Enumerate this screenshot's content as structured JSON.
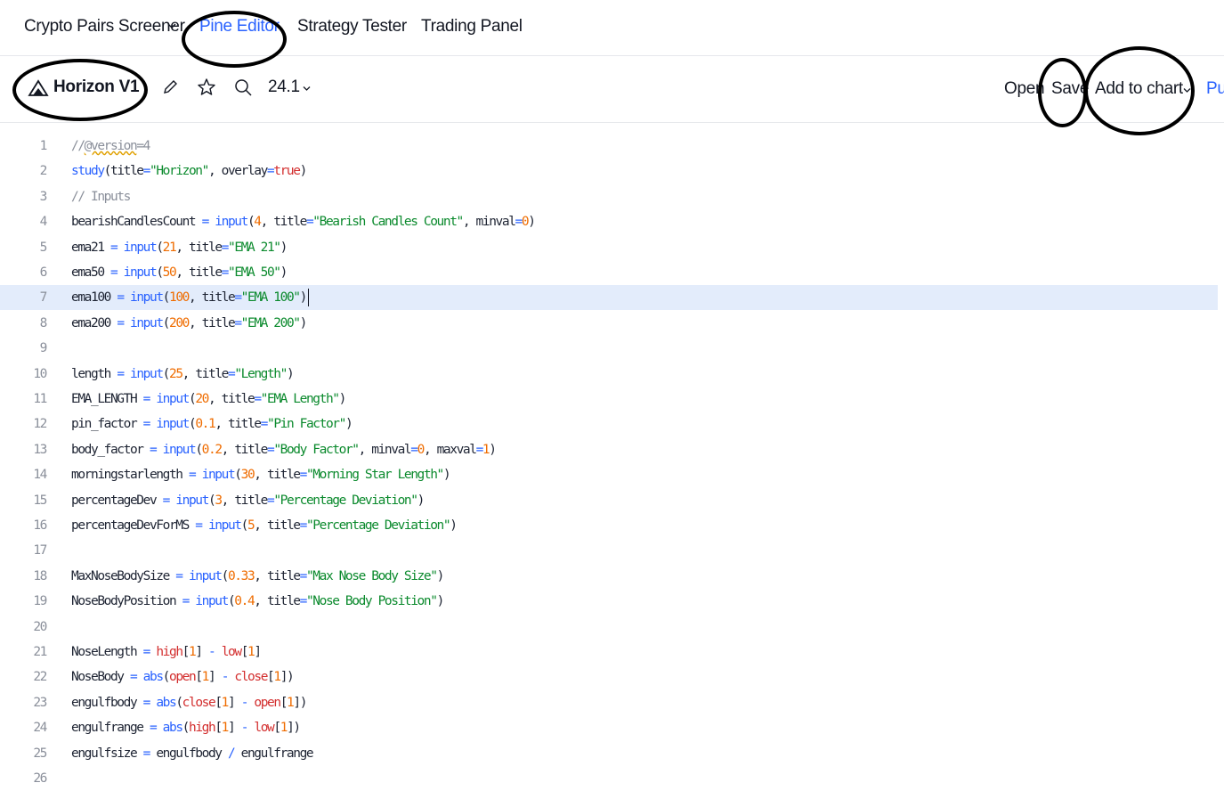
{
  "tabs": {
    "screener": "Crypto Pairs Screener",
    "pine_editor": "Pine Editor",
    "strategy_tester": "Strategy Tester",
    "trading_panel": "Trading Panel"
  },
  "toolbar": {
    "script_name": "Horizon V1",
    "version": "24.1",
    "open": "Open",
    "save": "Save",
    "add_to_chart": "Add to chart",
    "publish": "Pu"
  },
  "colors": {
    "accent": "#2962ff",
    "string": "#0b8a2d",
    "number": "#ef6c00",
    "builtin_var": "#d32f2f",
    "comment": "#8a8f9a",
    "highlight_line": "#e3ecfb"
  },
  "editor": {
    "highlighted_line": 7,
    "lines": [
      {
        "n": "1",
        "t": "//@version=4"
      },
      {
        "n": "2",
        "t": "study(title=\"Horizon\", overlay=true)"
      },
      {
        "n": "3",
        "t": "// Inputs"
      },
      {
        "n": "4",
        "t": "bearishCandlesCount = input(4, title=\"Bearish Candles Count\", minval=0)"
      },
      {
        "n": "5",
        "t": "ema21 = input(21, title=\"EMA 21\")"
      },
      {
        "n": "6",
        "t": "ema50 = input(50, title=\"EMA 50\")"
      },
      {
        "n": "7",
        "t": "ema100 = input(100, title=\"EMA 100\")"
      },
      {
        "n": "8",
        "t": "ema200 = input(200, title=\"EMA 200\")"
      },
      {
        "n": "9",
        "t": ""
      },
      {
        "n": "10",
        "t": "length = input(25, title=\"Length\")"
      },
      {
        "n": "11",
        "t": "EMA_LENGTH = input(20, title=\"EMA Length\")"
      },
      {
        "n": "12",
        "t": "pin_factor = input(0.1, title=\"Pin Factor\")"
      },
      {
        "n": "13",
        "t": "body_factor = input(0.2, title=\"Body Factor\", minval=0, maxval=1)"
      },
      {
        "n": "14",
        "t": "morningstarlength = input(30, title=\"Morning Star Length\")"
      },
      {
        "n": "15",
        "t": "percentageDev = input(3, title=\"Percentage Deviation\")"
      },
      {
        "n": "16",
        "t": "percentageDevForMS = input(5, title=\"Percentage Deviation\")"
      },
      {
        "n": "17",
        "t": ""
      },
      {
        "n": "18",
        "t": "MaxNoseBodySize = input(0.33, title=\"Max Nose Body Size\")"
      },
      {
        "n": "19",
        "t": "NoseBodyPosition = input(0.4, title=\"Nose Body Position\")"
      },
      {
        "n": "20",
        "t": ""
      },
      {
        "n": "21",
        "t": "NoseLength = high[1] - low[1]"
      },
      {
        "n": "22",
        "t": "NoseBody = abs(open[1] - close[1])"
      },
      {
        "n": "23",
        "t": "engulfbody = abs(close[1] - open[1])"
      },
      {
        "n": "24",
        "t": "engulfrange = abs(high[1] - low[1])"
      },
      {
        "n": "25",
        "t": "engulfsize = engulfbody / engulfrange"
      },
      {
        "n": "26",
        "t": ""
      }
    ]
  }
}
